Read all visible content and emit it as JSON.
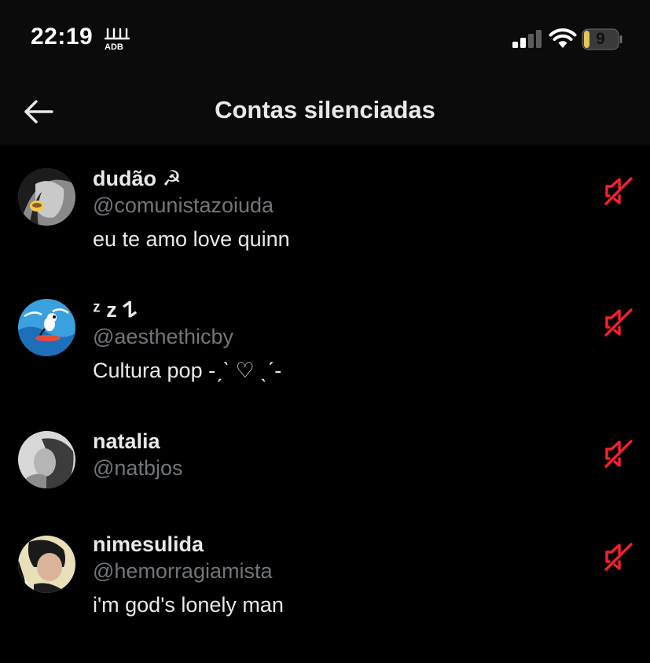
{
  "status_bar": {
    "time": "22:19",
    "battery_level": "9"
  },
  "header": {
    "title": "Contas silenciadas"
  },
  "accounts": [
    {
      "name": "dudão ☭",
      "handle": "@comunistazoiuda",
      "bio": "eu te amo love quinn"
    },
    {
      "name": "ᶻ z 𐰁",
      "handle": "@aesthethicby",
      "bio": "Cultura pop -ˏˋ ♡ ˎˊ-"
    },
    {
      "name": "natalia",
      "handle": "@natbjos",
      "bio": ""
    },
    {
      "name": "nimesulida",
      "handle": "@hemorragiamista",
      "bio": "i'm god's lonely man"
    }
  ],
  "icons": {
    "back": "arrow-left-icon",
    "unmute": "muted-speaker-icon"
  },
  "colors": {
    "background": "#000000",
    "primary_text": "#e7e9ea",
    "secondary_text": "#71767b",
    "mute_icon": "#f4212e",
    "battery_fill": "#e2c85a"
  }
}
